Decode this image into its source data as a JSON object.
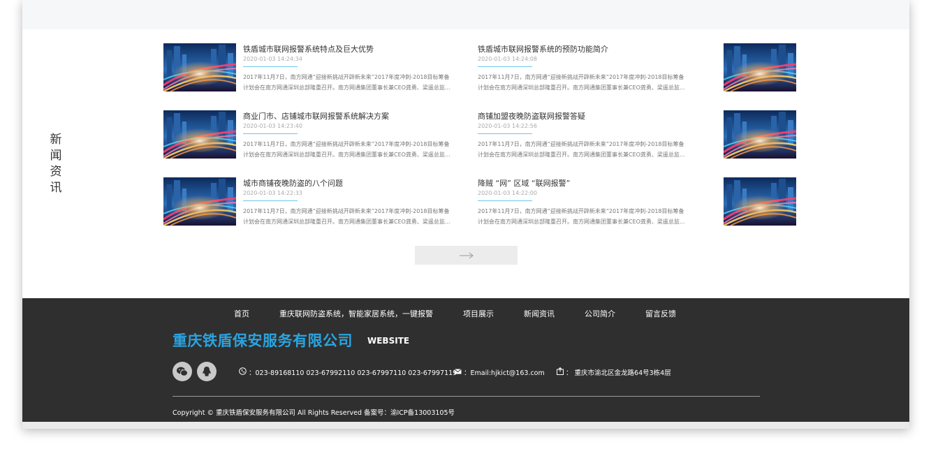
{
  "section_label": [
    "新",
    "闻",
    "资",
    "讯"
  ],
  "news": [
    {
      "title": "铁盾城市联网报警系统特点及巨大优势",
      "date": "2020-01-03 14:24:34",
      "excerpt1": " 2017年11月7日，南方网通“迎接新挑战开辟新未来”2017年度冲刺-2018目标筹备",
      "excerpt2": "计划会在南方网通深圳总部隆重召开。南方网通集团董事长兼CEO龚勇、梁遥总监..."
    },
    {
      "title": "铁盾城市联网报警系统的预防功能简介",
      "date": "2020-01-03 14:24:08",
      "excerpt1": " 2017年11月7日，南方网通“迎接新挑战开辟新未来”2017年度冲刺-2018目标筹备",
      "excerpt2": "计划会在南方网通深圳总部隆重召开。南方网通集团董事长兼CEO龚勇、梁遥总监..."
    },
    {
      "title": "商业门市、店铺城市联网报警系统解决方案",
      "date": "2020-01-03 14:23:40",
      "excerpt1": " 2017年11月7日，南方网通“迎接新挑战开辟新未来”2017年度冲刺-2018目标筹备",
      "excerpt2": "计划会在南方网通深圳总部隆重召开。南方网通集团董事长兼CEO龚勇、梁遥总监..."
    },
    {
      "title": "商铺加盟夜晚防盗联网报警答疑",
      "date": "2020-01-03 14:22:56",
      "excerpt1": " 2017年11月7日，南方网通“迎接新挑战开辟新未来”2017年度冲刺-2018目标筹备",
      "excerpt2": "计划会在南方网通深圳总部隆重召开。南方网通集团董事长兼CEO龚勇、梁遥总监..."
    },
    {
      "title": "城市商铺夜晚防盗的八个问题",
      "date": "2020-01-03 14:22:33",
      "excerpt1": " 2017年11月7日，南方网通“迎接新挑战开辟新未来”2017年度冲刺-2018目标筹备",
      "excerpt2": "计划会在南方网通深圳总部隆重召开。南方网通集团董事长兼CEO龚勇、梁遥总监..."
    },
    {
      "title": "降贼 “网” 区域 “联网报警”",
      "date": "2020-01-03 14:22:00",
      "excerpt1": " 2017年11月7日，南方网通“迎接新挑战开辟新未来”2017年度冲刺-2018目标筹备",
      "excerpt2": "计划会在南方网通深圳总部隆重召开。南方网通集团董事长兼CEO龚勇、梁遥总监..."
    }
  ],
  "more_button_icon": "arrow-right-icon",
  "footer": {
    "nav": [
      "首页",
      "重庆联网防盗系统，智能家居系统，一键报警",
      "项目展示",
      "新闻资讯",
      "公司简介",
      "留言反馈"
    ],
    "company_name": "重庆铁盾保安服务有限公司",
    "website_label": "WEBSITE",
    "phone": "：023-89168110 023-67992110 023-67997110 023-67997119",
    "email": "：Email:hjkict@163.com",
    "address": "：  重庆市渝北区金龙路64号3栋4层",
    "copyright": "Copyright © 重庆铁盾保安服务有限公司 All Rights Reserved 备案号：渝ICP备13003105号",
    "icons": {
      "wechat": "wechat-icon",
      "qq": "qq-icon",
      "phone": "phone-icon",
      "email": "mail-icon",
      "address": "location-icon"
    }
  },
  "colors": {
    "accent": "#2aa4e0",
    "footer_bg": "#2f2f2f",
    "rule": "#6ec6ea"
  }
}
